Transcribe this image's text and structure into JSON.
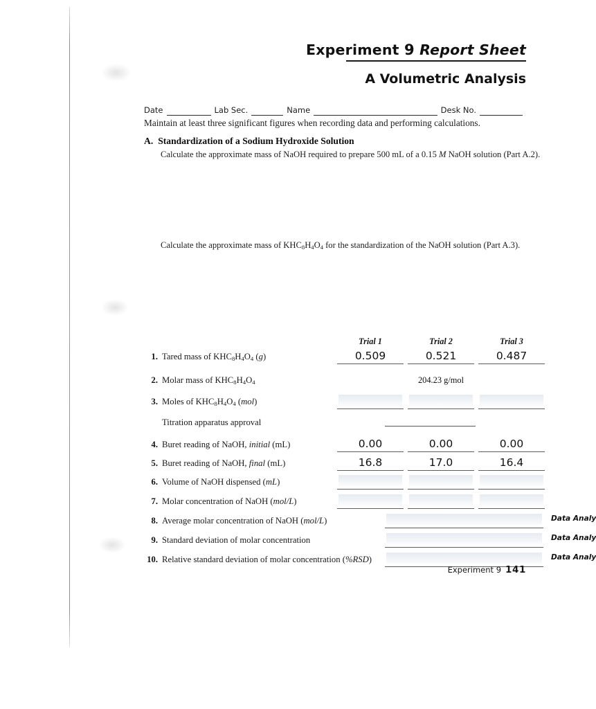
{
  "document": {
    "title_experiment_word": "Experiment",
    "title_experiment_number": "9",
    "title_report_sheet": "Report Sheet",
    "subtitle": "A Volumetric Analysis"
  },
  "identity": {
    "date_label": "Date",
    "lab_sec_label": "Lab Sec.",
    "name_label": "Name",
    "desk_no_label": "Desk No.",
    "date_value": "",
    "lab_sec_value": "",
    "name_value": "",
    "desk_no_value": ""
  },
  "instructions": {
    "maintain": "Maintain at least three significant figures when recording data and performing calculations."
  },
  "section_a": {
    "letter": "A.",
    "heading": "Standardization of a Sodium Hydroxide Solution",
    "prompt_1_pre": "Calculate the approximate mass of NaOH required to prepare 500 mL of a 0.15 ",
    "prompt_1_ital": "M",
    "prompt_1_post": " NaOH solution (Part A.2).",
    "prompt_2_pre": "Calculate the approximate mass of KHC",
    "prompt_2_post": " for the standardization of the NaOH solution (Part A.3)."
  },
  "table": {
    "column_headers": [
      "Trial 1",
      "Trial 2",
      "Trial 3"
    ],
    "rows": [
      {
        "num": "1.",
        "label_pre": "Tared mass of KHC",
        "label_post": " (",
        "label_unit": "g",
        "label_end": ")",
        "kind": "three-col",
        "values": [
          "0.509",
          "0.521",
          "0.487"
        ],
        "filled": true
      },
      {
        "num": "2.",
        "label_pre": "Molar mass of KHC",
        "label_post": "",
        "label_unit": "",
        "label_end": "",
        "kind": "center-single",
        "values": [
          "204.23 g/mol"
        ],
        "filled": true
      },
      {
        "num": "3.",
        "label_pre": "Moles of KHC",
        "label_post": " (",
        "label_unit": "mol",
        "label_end": ")",
        "kind": "three-col",
        "values": [
          "",
          "",
          ""
        ],
        "filled": false
      },
      {
        "num": "",
        "label_plain": "Titration apparatus approval",
        "kind": "approval",
        "values": [],
        "filled": false
      },
      {
        "num": "4.",
        "label_plain_pre": "Buret reading of NaOH, ",
        "label_unit": "initial",
        "label_plain_post": " (mL)",
        "kind": "three-col",
        "values": [
          "0.00",
          "0.00",
          "0.00"
        ],
        "filled": true
      },
      {
        "num": "5.",
        "label_plain_pre": "Buret reading of NaOH, ",
        "label_unit": "final",
        "label_plain_post": " (mL)",
        "kind": "three-col",
        "values": [
          "16.8",
          "17.0",
          "16.4"
        ],
        "filled": true
      },
      {
        "num": "6.",
        "label_plain_pre": "Volume of NaOH dispensed (",
        "label_unit": "mL",
        "label_plain_post": ")",
        "kind": "three-col",
        "values": [
          "",
          "",
          ""
        ],
        "filled": false
      },
      {
        "num": "7.",
        "label_plain_pre": "Molar concentration of NaOH (",
        "label_unit": "mol/L",
        "label_plain_post": ")",
        "kind": "three-col",
        "values": [
          "",
          "",
          ""
        ],
        "filled": false
      },
      {
        "num": "8.",
        "label_plain_pre": "Average molar concentration of NaOH (",
        "label_unit": "mol/L",
        "label_plain_post": ")",
        "kind": "wide",
        "values": [
          ""
        ],
        "tag": "Data Analysis, B",
        "filled": false
      },
      {
        "num": "9.",
        "label_plain_pre": "Standard deviation of molar concentration",
        "label_unit": "",
        "label_plain_post": "",
        "kind": "wide",
        "values": [
          ""
        ],
        "tag": "Data Analysis, C",
        "filled": false
      },
      {
        "num": "10.",
        "label_plain_pre": "Relative standard deviation of molar concentration (",
        "label_unit": "%RSD",
        "label_plain_post": ")",
        "kind": "wide",
        "values": [
          ""
        ],
        "tag": "Data Analysis, B",
        "filled": false
      }
    ],
    "compound_formula": {
      "k": "KHC",
      "sub1": "8",
      "h": "H",
      "sub2": "4",
      "o": "O",
      "sub3": "4"
    }
  },
  "footer": {
    "experiment_label": "Experiment 9",
    "page_number": "141"
  },
  "colors": {
    "ink": "#1a1a1a",
    "rule": "#5c5c5c",
    "paper": "#ffffff"
  }
}
